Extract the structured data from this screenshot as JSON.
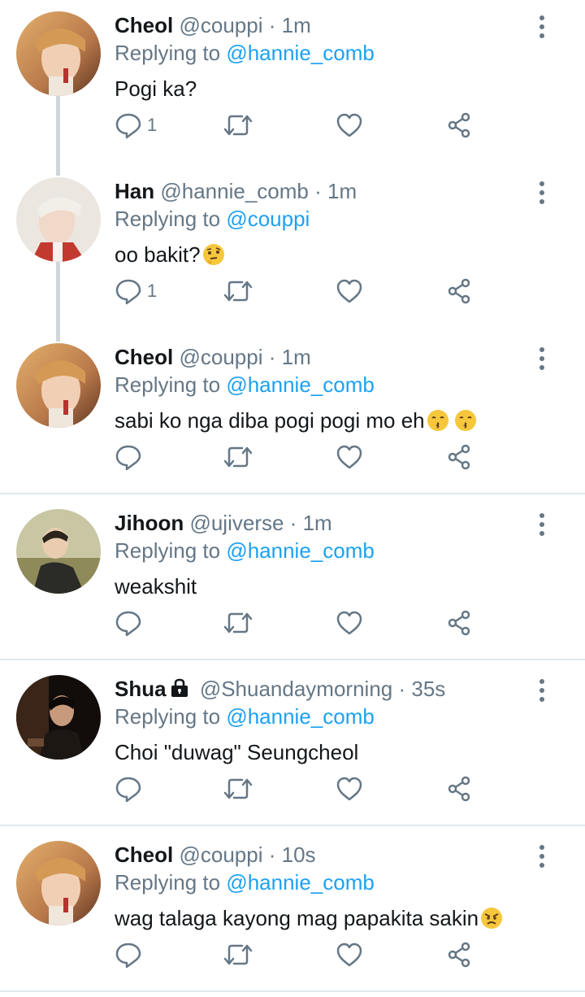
{
  "tweets": [
    {
      "name": "Cheol",
      "handle": "@couppi",
      "time": "1m",
      "reply_prefix": "Replying to",
      "reply_to": "@hannie_comb",
      "text": "Pogi ka?",
      "reply_count": "1",
      "avatar_colors": [
        "#d9a15e",
        "#7a4a2c"
      ],
      "locked": false,
      "emoji": ""
    },
    {
      "name": "Han",
      "handle": "@hannie_comb",
      "time": "1m",
      "reply_prefix": "Replying to",
      "reply_to": "@couppi",
      "text": "oo bakit?",
      "reply_count": "1",
      "avatar_colors": [
        "#e9e2dd",
        "#c63a2e"
      ],
      "locked": false,
      "emoji": "thinking-face"
    },
    {
      "name": "Cheol",
      "handle": "@couppi",
      "time": "1m",
      "reply_prefix": "Replying to",
      "reply_to": "@hannie_comb",
      "text": "sabi ko nga diba pogi pogi mo eh",
      "reply_count": "",
      "avatar_colors": [
        "#d9a15e",
        "#7a4a2c"
      ],
      "locked": false,
      "emoji": "kissing-face-double"
    },
    {
      "name": "Jihoon",
      "handle": "@ujiverse",
      "time": "1m",
      "reply_prefix": "Replying to",
      "reply_to": "@hannie_comb",
      "text": "weakshit",
      "reply_count": "",
      "avatar_colors": [
        "#b7b18a",
        "#3a3a36"
      ],
      "locked": false,
      "emoji": ""
    },
    {
      "name": "Shua",
      "handle": "@Shuandaymorning",
      "time": "35s",
      "reply_prefix": "Replying to",
      "reply_to": "@hannie_comb",
      "text": "Choi \"duwag\" Seungcheol",
      "reply_count": "",
      "avatar_colors": [
        "#3a2b22",
        "#0e0b0a"
      ],
      "locked": true,
      "emoji": ""
    },
    {
      "name": "Cheol",
      "handle": "@couppi",
      "time": "10s",
      "reply_prefix": "Replying to",
      "reply_to": "@hannie_comb",
      "text": "wag talaga kayong mag papakita sakin",
      "reply_count": "",
      "avatar_colors": [
        "#d9a15e",
        "#7a4a2c"
      ],
      "locked": false,
      "emoji": "angry-face"
    }
  ],
  "colors": {
    "accent": "#1da1f2",
    "muted": "#657786",
    "text": "#14171a",
    "thread_line": "#cfd6dc",
    "divider": "#e1e8ed"
  }
}
